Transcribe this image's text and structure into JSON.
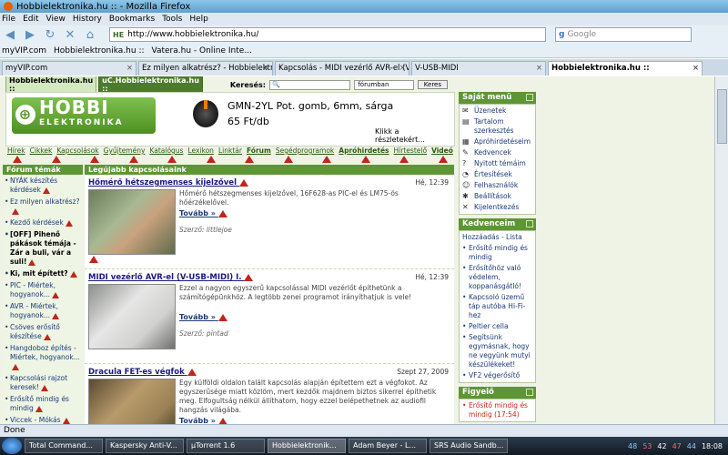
{
  "window": {
    "title": "Hobbielektronika.hu :: - Mozilla Firefox"
  },
  "menu": [
    "File",
    "Edit",
    "View",
    "History",
    "Bookmarks",
    "Tools",
    "Help"
  ],
  "nav": {
    "url": "http://www.hobbielektronika.hu/",
    "url_badge": "HE",
    "search_placeholder": "Google"
  },
  "bookmarks": [
    "myVIP.com",
    "Hobbielektronika.hu ::",
    "Vatera.hu - Online Inte..."
  ],
  "tabs": [
    {
      "label": "myVIP.com"
    },
    {
      "label": "Ez milyen alkatrész? - Hobbielektro..."
    },
    {
      "label": "Kapcsolás - MIDI vezérlő AVR-el (V..."
    },
    {
      "label": "V-USB-MIDI"
    },
    {
      "label": "Hobbielektronika.hu ::"
    }
  ],
  "site": {
    "tab1": "Hobbielektronika.hu ::",
    "tab2": "uC.Hobbielektronika.hu ::",
    "search_label": "Keresés:",
    "search_scope": "fórumban",
    "search_button": "Keres",
    "logo_line1": "HOBBI",
    "logo_line2": "ELEKTRONIKA",
    "ad_title": "GMN-2YL Pot. gomb, 6mm, sárga",
    "ad_price": "65 Ft/db",
    "ad_more": "Klikk a részletekért...",
    "navlinks": [
      "Hírek",
      "Cikkek",
      "Kapcsolások",
      "Gyűjtemény",
      "Katalógus",
      "Lexikon",
      "Linktár",
      "Fórum",
      "Segédprogramok",
      "Apróhirdetés",
      "Hírtestelő",
      "Videó"
    ]
  },
  "forum": {
    "heading": "Fórum témák",
    "items": [
      {
        "text": "NYÁK készítés kérdések",
        "bold": false
      },
      {
        "text": "Ez milyen alkatrész?",
        "bold": false
      },
      {
        "text": "Kezdő kérdések",
        "bold": false
      },
      {
        "text": "[OFF] Pihenő pákások témája - Zár a buli, vár a suli!",
        "bold": true
      },
      {
        "text": "Ki, mit épített?",
        "bold": true
      },
      {
        "text": "PIC - Miértek, hogyanok...",
        "bold": false
      },
      {
        "text": "AVR - Miértek, hogyanok...",
        "bold": false
      },
      {
        "text": "Csöves erősítő készítése",
        "bold": false
      },
      {
        "text": "Hangdoboz építés - Miértek, hogyanok...",
        "bold": false
      },
      {
        "text": "Kapcsolási rajzot keresek!",
        "bold": false
      },
      {
        "text": "Erősítő mindig és mindig",
        "bold": false
      },
      {
        "text": "Viccek - Mókás",
        "bold": false
      }
    ]
  },
  "latest": {
    "heading": "Legújabb kapcsolásaink",
    "articles": [
      {
        "title": "Hőmérő hétszegmenses kijelzővel",
        "date": "Hé, 12:39",
        "text": "Hőmérő hétszegmenses kijelzővel, 16F628-as PIC-el és LM75-ös hőérzékelővel.",
        "more": "Tovább »",
        "author": "Szerző: littlejoe"
      },
      {
        "title": "MIDI vezérlő AVR-el (V-USB-MIDI) I.",
        "date": "Hé, 12:39",
        "text": "Ezzel a nagyon egyszerű kapcsolással MIDI vezérlőt építhetünk a számítógépünkhöz. A legtöbb zenei programot irányíthatjuk is vele!",
        "more": "Tovább »",
        "author": "Szerző: pintad"
      },
      {
        "title": "Dracula FET-es végfok",
        "date": "Szept 27, 2009",
        "text": "Egy külföldi oldalon talált kapcsolás alapján építettem ezt a végfokot. Az egyszerűsége miatt közlöm, mert kezdők majdnem biztos sikerrel építhetik meg. Elfogultság nélkül állíthatom, hogy ezzel belépethetnek az audiofil hangzás világába.",
        "more": "Tovább »",
        "author": ""
      }
    ]
  },
  "mymenu": {
    "heading": "Saját menü",
    "items": [
      {
        "icon": "envelope-icon",
        "glyph": "✉",
        "text": "Üzenetek"
      },
      {
        "icon": "document-icon",
        "glyph": "▤",
        "text": "Tartalom szerkesztés"
      },
      {
        "icon": "classifieds-icon",
        "glyph": "▦",
        "text": "Apróhirdetéseim"
      },
      {
        "icon": "favorites-icon",
        "glyph": "✎",
        "text": "Kedvencek"
      },
      {
        "icon": "question-icon",
        "glyph": "?",
        "text": "Nyitott témáim"
      },
      {
        "icon": "bell-icon",
        "glyph": "◔",
        "text": "Értesítések"
      },
      {
        "icon": "users-icon",
        "glyph": "☺",
        "text": "Felhasználók"
      },
      {
        "icon": "tools-icon",
        "glyph": "✱",
        "text": "Beállítások"
      },
      {
        "icon": "logout-icon",
        "glyph": "✕",
        "text": "Kijelentkezés"
      }
    ]
  },
  "favorites": {
    "heading": "Kedvenceim",
    "add": "Hozzáadás - Lista",
    "items": [
      "Erősítő mindig és mindig",
      "Erősítőhöz való védelem, koppanásgátló!",
      "Kapcsoló üzemű táp autóba Hi-Fi-hez",
      "Peltier cella",
      "Segítsünk egymásnak, hogy ne vegyünk mutyi készülékeket!",
      "VF2 végerősítő"
    ]
  },
  "watch": {
    "heading": "Figyelő",
    "items": [
      "Erősítő mindig és mindig (17:54)"
    ]
  },
  "status": "Done",
  "taskbar": {
    "buttons": [
      "Total Command...",
      "Kaspersky Anti-V...",
      "µTorrent 1.6",
      "Hobbielektronik...",
      "Adam Beyer - L...",
      "SRS Audio Sandb..."
    ],
    "tray": [
      "48",
      "53",
      "42",
      "47",
      "44"
    ],
    "clock": "18:08"
  }
}
